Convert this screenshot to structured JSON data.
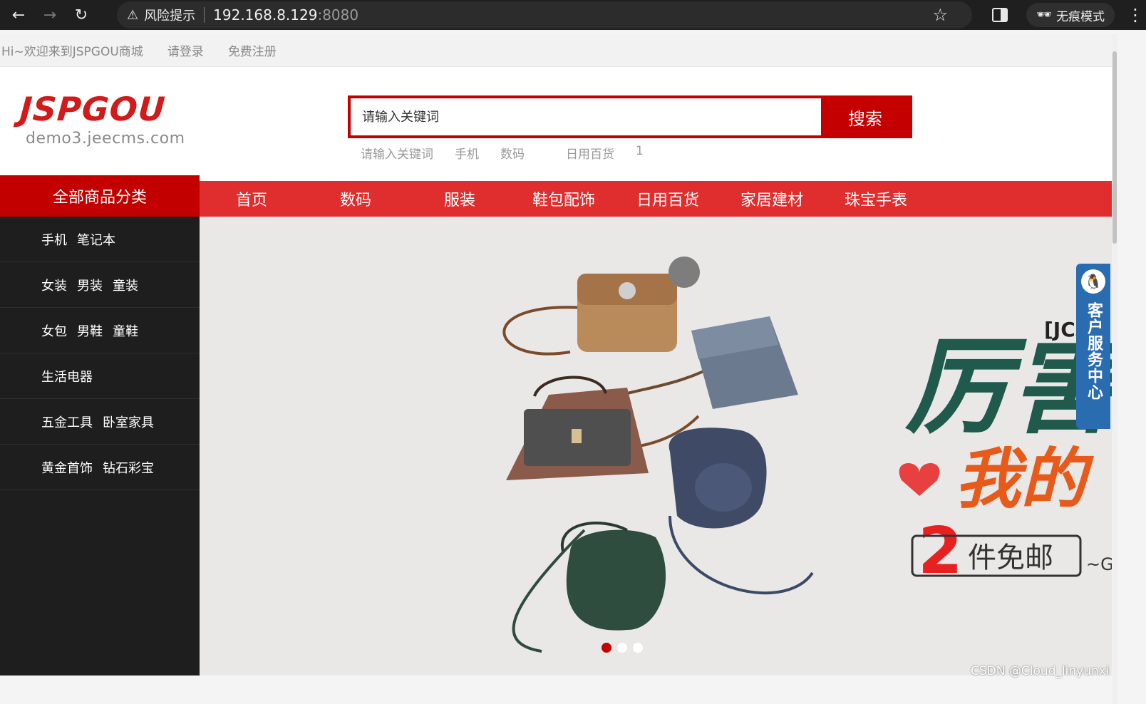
{
  "browser": {
    "warning_label": "风险提示",
    "url_host": "192.168.8.129",
    "url_port": ":8080",
    "incognito_label": "无痕模式"
  },
  "topbar": {
    "welcome": "Hi~欢迎来到JSPGOU商城",
    "login": "请登录",
    "register": "免费注册"
  },
  "logo": {
    "main": "JSPGOU",
    "sub": "demo3.jeecms.com"
  },
  "search": {
    "placeholder": "请输入关键词",
    "button": "搜索",
    "hot_words": [
      "请输入关键词",
      "手机",
      "数码",
      "日用百货",
      "1"
    ]
  },
  "nav": {
    "all_categories": "全部商品分类",
    "items": [
      "首页",
      "数码",
      "服装",
      "鞋包配饰",
      "日用百货",
      "家居建材",
      "珠宝手表"
    ]
  },
  "categories": [
    [
      "手机",
      "笔记本"
    ],
    [
      "女装",
      "男装",
      "童装"
    ],
    [
      "女包",
      "男鞋",
      "童鞋"
    ],
    [
      "生活电器"
    ],
    [
      "五金工具",
      "卧室家具"
    ],
    [
      "黄金首饰",
      "钻石彩宝"
    ]
  ],
  "banner": {
    "bracket_text": "[JC",
    "title_1": "厉害",
    "title_2": "我的",
    "number": "2",
    "promo": "件免邮",
    "tail": "~G",
    "carousel_count": 3,
    "active_index": 0
  },
  "customer_service": {
    "label": "客户服务中心"
  },
  "watermark": "CSDN @Cloud_linyunxi"
}
